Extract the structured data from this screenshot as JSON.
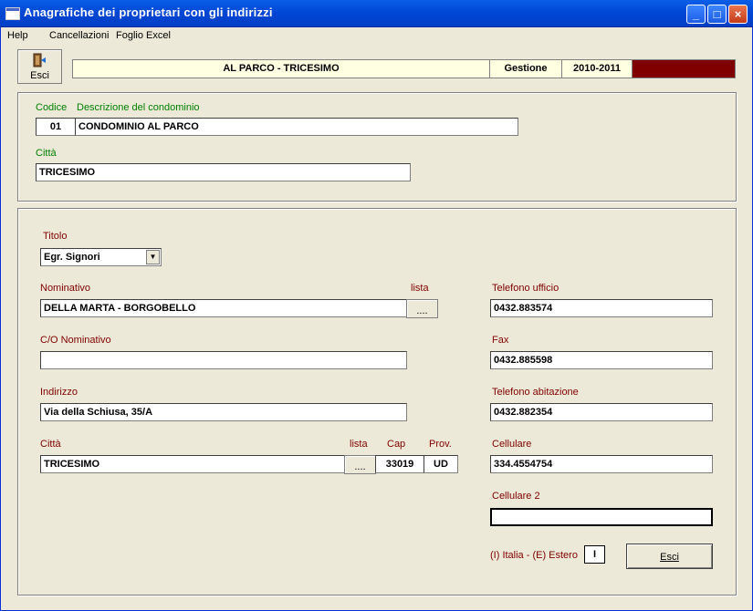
{
  "window": {
    "title": "Anagrafiche dei proprietari con gli indirizzi"
  },
  "menu": [
    {
      "label": "Help"
    },
    {
      "label": "Cancellazioni"
    },
    {
      "label": "Foglio Excel"
    }
  ],
  "toolbar": {
    "exit_label": "Esci"
  },
  "header": {
    "condominio": "AL PARCO - TRICESIMO",
    "gestione_label": "Gestione",
    "gestione_value": "2010-2011",
    "accent_color": "#800000"
  },
  "condominio": {
    "codice_label": "Codice",
    "descrizione_label": "Descrizione del condominio",
    "codice": "01",
    "descrizione": "CONDOMINIO AL PARCO",
    "citta_label": "Città",
    "citta": "TRICESIMO"
  },
  "proprietario": {
    "titolo_label": "Titolo",
    "titolo": "Egr. Signori",
    "nominativo_label": "Nominativo",
    "lista_label": "lista",
    "nominativo": "DELLA MARTA - BORGOBELLO",
    "lista_button": "....",
    "co_label": "C/O Nominativo",
    "co_value": "",
    "indirizzo_label": "Indirizzo",
    "indirizzo": "Via della Schiusa, 35/A",
    "citta_label": "Città",
    "citta_lista_label": "lista",
    "cap_label": "Cap",
    "prov_label": "Prov.",
    "citta": "TRICESIMO",
    "citta_lista_button": "....",
    "cap": "33019",
    "prov": "UD",
    "tel_ufficio_label": "Telefono ufficio",
    "tel_ufficio": "0432.883574",
    "fax_label": "Fax",
    "fax": "0432.885598",
    "tel_abitazione_label": "Telefono abitazione",
    "tel_abitazione": "0432.882354",
    "cellulare_label": "Cellulare",
    "cellulare": "334.4554754",
    "cellulare2_label": "Cellulare 2",
    "cellulare2": "",
    "nazione_label": "(I) Italia - (E) Estero",
    "nazione": "I",
    "esci_button": "Esci"
  },
  "icons": {
    "exit": "door-exit-icon",
    "app": "window-icon"
  }
}
